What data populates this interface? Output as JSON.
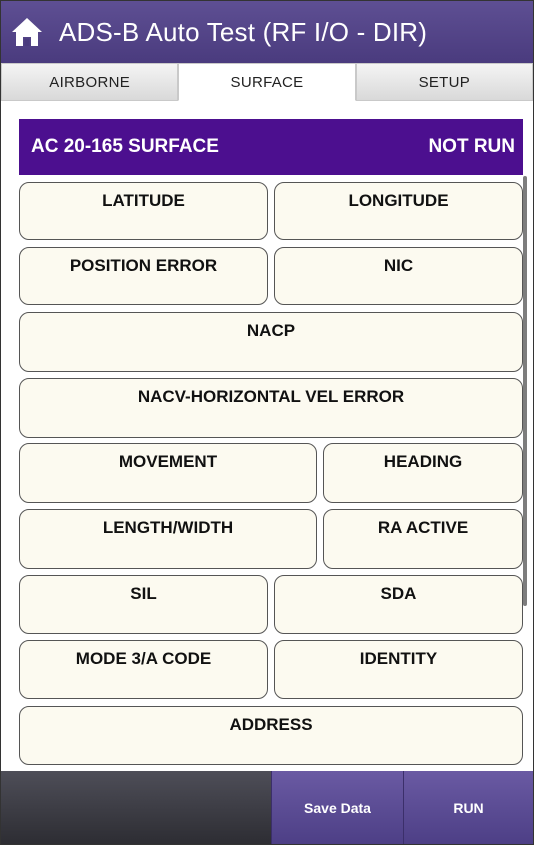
{
  "app": {
    "title": "ADS-B Auto Test (RF I/O - DIR)",
    "accent": "#4c0f8f",
    "home_icon": "home-icon"
  },
  "tabs": [
    {
      "label": "AIRBORNE",
      "active": false
    },
    {
      "label": "SURFACE",
      "active": true
    },
    {
      "label": "SETUP",
      "active": false
    }
  ],
  "panel": {
    "title": "AC 20-165 SURFACE",
    "status": "NOT RUN"
  },
  "fields": {
    "latitude": "LATITUDE",
    "longitude": "LONGITUDE",
    "position_error": "POSITION ERROR",
    "nic": "NIC",
    "nacp": "NACP",
    "nacv": "NACV-HORIZONTAL VEL ERROR",
    "movement": "MOVEMENT",
    "heading": "HEADING",
    "length_width": "LENGTH/WIDTH",
    "ra_active": "RA ACTIVE",
    "sil": "SIL",
    "sda": "SDA",
    "mode3a": "MODE 3/A CODE",
    "identity": "IDENTITY",
    "address": "ADDRESS"
  },
  "actions": {
    "save": "Save Data",
    "run": "RUN"
  }
}
